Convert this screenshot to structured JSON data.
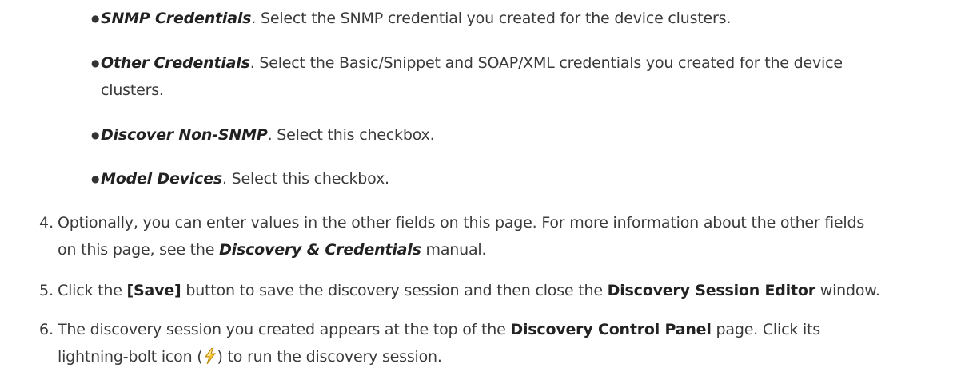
{
  "bullets": [
    {
      "term": "SNMP Credentials",
      "text": ". Select the SNMP credential you created for the device clusters."
    },
    {
      "term": "Other Credentials",
      "text": ". Select the Basic/Snippet and SOAP/XML credentials you created for the device",
      "continuation": "clusters."
    },
    {
      "term": "Discover Non-SNMP",
      "text": ". Select this checkbox."
    },
    {
      "term": "Model Devices",
      "text": ". Select this checkbox."
    }
  ],
  "steps": [
    {
      "num": "4.",
      "line1": "Optionally, you can enter values in the other fields on this page. For more information about the other fields",
      "line2_pre": "on this page, see the ",
      "line2_em": "Discovery & Credentials",
      "line2_post": " manual."
    },
    {
      "num": "5.",
      "pre": "Click the ",
      "button": "[Save]",
      "mid": " button to save the discovery session and then close the ",
      "window": "Discovery Session Editor",
      "post": " window."
    },
    {
      "num": "6.",
      "pre": "The discovery session you created appears at the top of the ",
      "page": "Discovery Control Panel",
      "mid": " page. Click its",
      "line2_pre": "lightning-bolt icon (",
      "icon": "lightning-bolt-icon",
      "line2_post": ") to run the discovery session."
    }
  ],
  "colors": {
    "text": "#3a3a3a",
    "emphasis": "#222222",
    "bolt_fill": "#f2c230",
    "bolt_edge": "#b8860b"
  }
}
